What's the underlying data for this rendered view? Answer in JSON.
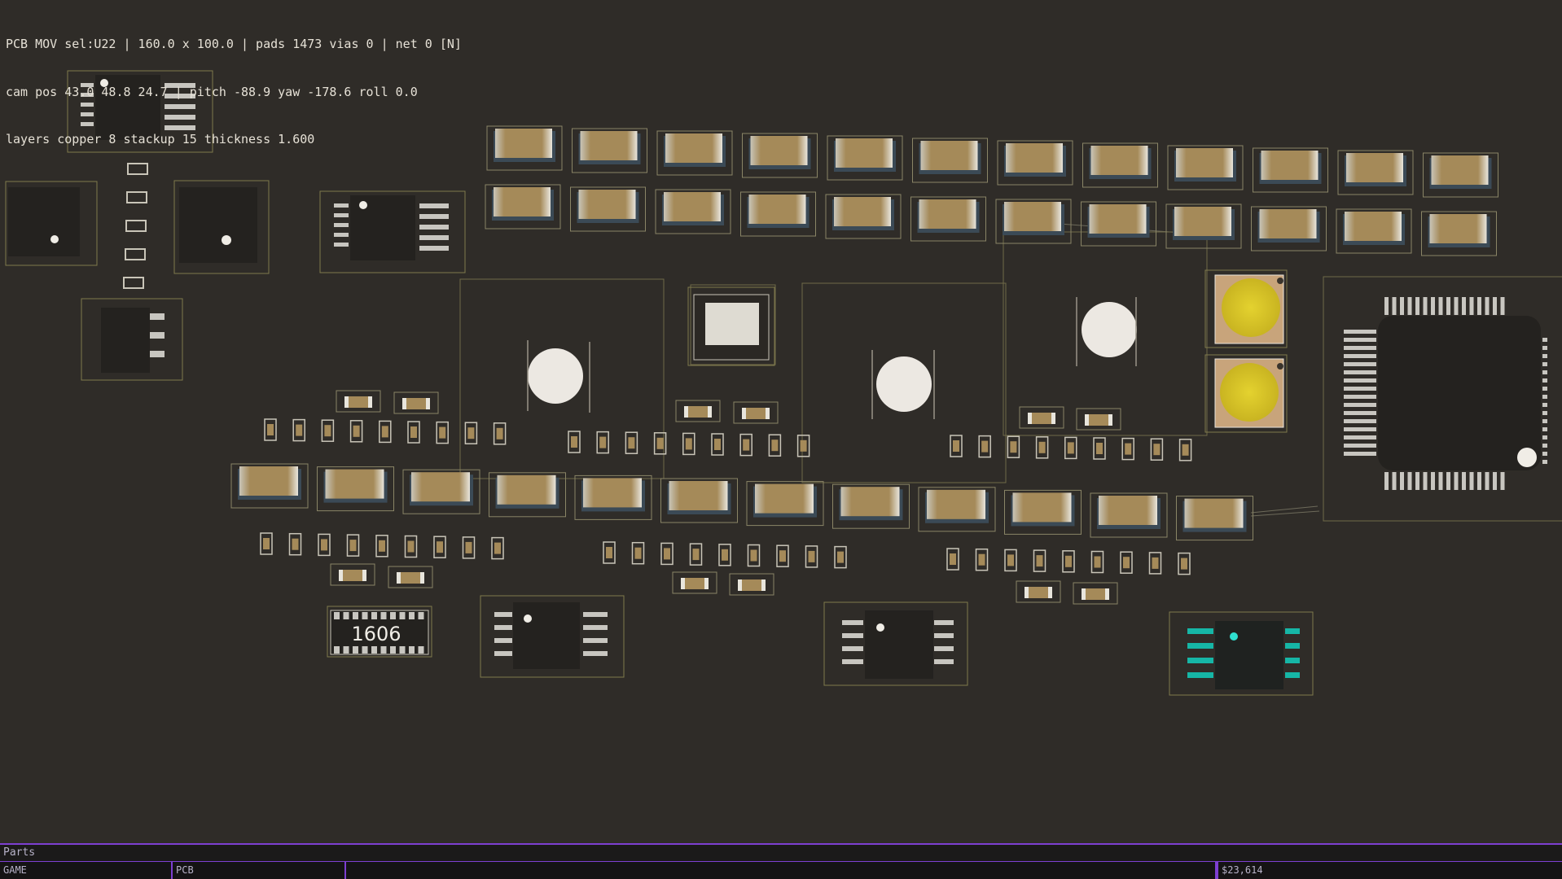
{
  "hud": {
    "line1": "PCB MOV sel:U22 | 160.0 x 100.0 | pads 1473 vias 0 | net 0 [N]",
    "line2": "cam pos 43.0 48.8 24.7 | pitch -88.9 yaw -178.6 roll 0.0",
    "line3": "layers copper 8 stackup 15 thickness 1.600"
  },
  "board": {
    "resistor_array_label": "1606",
    "colors": {
      "background": "#2f2c28",
      "outline": "#7f7a4c",
      "chip_body": "#24221f",
      "copper_pad": "#a58a59",
      "led": "#d9c62a",
      "accent_bar": "#7d3fd1",
      "teal_pin": "#16b6a6"
    }
  },
  "parts_bar": {
    "label": "Parts"
  },
  "status_bar": {
    "mode": "GAME",
    "view": "PCB",
    "middle": "",
    "money": "$23,614"
  }
}
